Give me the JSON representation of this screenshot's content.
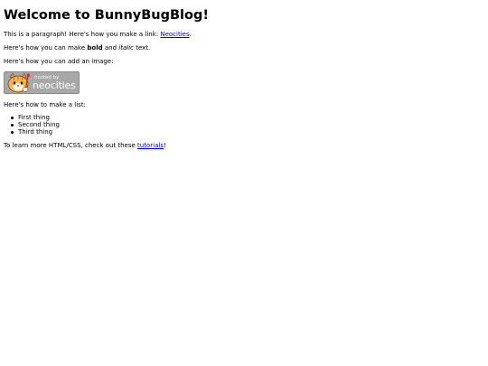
{
  "heading": "Welcome to BunnyBugBlog!",
  "p1": {
    "before": "This is a paragraph! Here's how you make a link: ",
    "link": "Neocities",
    "after": "."
  },
  "p2": {
    "before": "Here's how you can make ",
    "bold": "bold",
    "middle": " and ",
    "italic": "italic",
    "after": " text."
  },
  "p3": "Here's how you can add an image:",
  "badge": {
    "hosted": "hosted by",
    "brand": "neocities",
    "mascot_icon": "neocities-cat-icon",
    "bg_color": "#a8a8a8"
  },
  "p4": "Here's how to make a list:",
  "list": [
    "First thing",
    "Second thing",
    "Third thing"
  ],
  "p5": {
    "before": "To learn more HTML/CSS, check out these ",
    "link": "tutorials",
    "after": "!"
  },
  "colors": {
    "link": "#0000ee",
    "text": "#000000",
    "background": "#ffffff"
  }
}
